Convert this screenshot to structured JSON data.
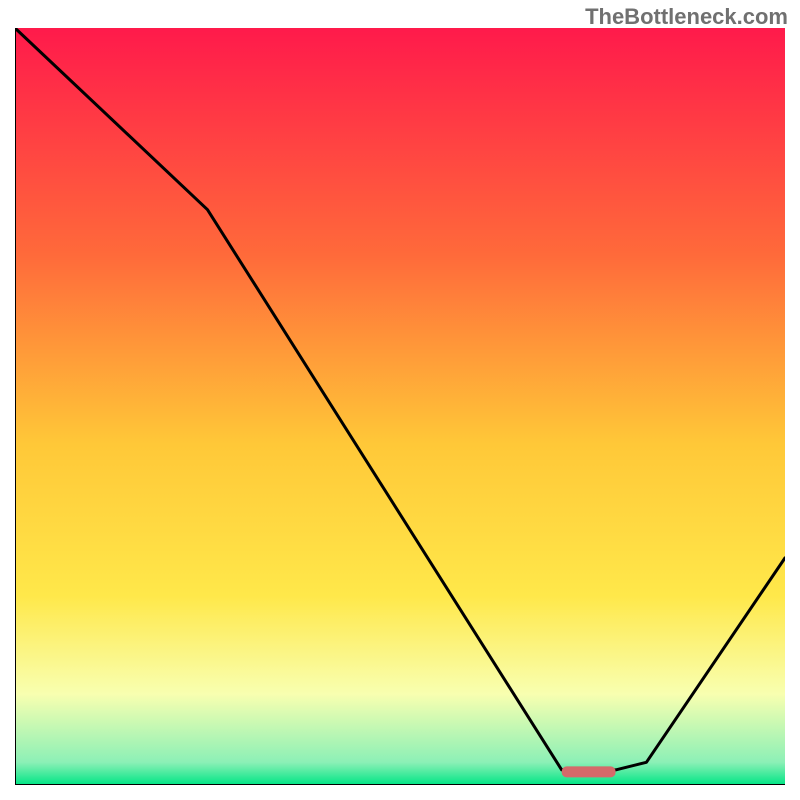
{
  "watermark": "TheBottleneck.com",
  "chart_data": {
    "type": "line",
    "title": "",
    "xlabel": "",
    "ylabel": "",
    "xlim": [
      0,
      100
    ],
    "ylim": [
      0,
      100
    ],
    "background_gradient": {
      "stops": [
        {
          "offset": 0,
          "color": "#ff1a4b"
        },
        {
          "offset": 30,
          "color": "#ff6a3a"
        },
        {
          "offset": 55,
          "color": "#ffc838"
        },
        {
          "offset": 75,
          "color": "#ffe84a"
        },
        {
          "offset": 88,
          "color": "#f8ffb0"
        },
        {
          "offset": 97,
          "color": "#8cf0b6"
        },
        {
          "offset": 100,
          "color": "#00e585"
        }
      ]
    },
    "series": [
      {
        "name": "bottleneck-curve",
        "color": "#000000",
        "x": [
          0,
          25,
          71,
          78,
          82,
          100
        ],
        "values": [
          100,
          76,
          2,
          2,
          3,
          30
        ]
      }
    ],
    "marker": {
      "name": "optimal-marker",
      "color": "#d46a6a",
      "x_start": 71,
      "x_end": 78,
      "y": 1.8
    }
  }
}
